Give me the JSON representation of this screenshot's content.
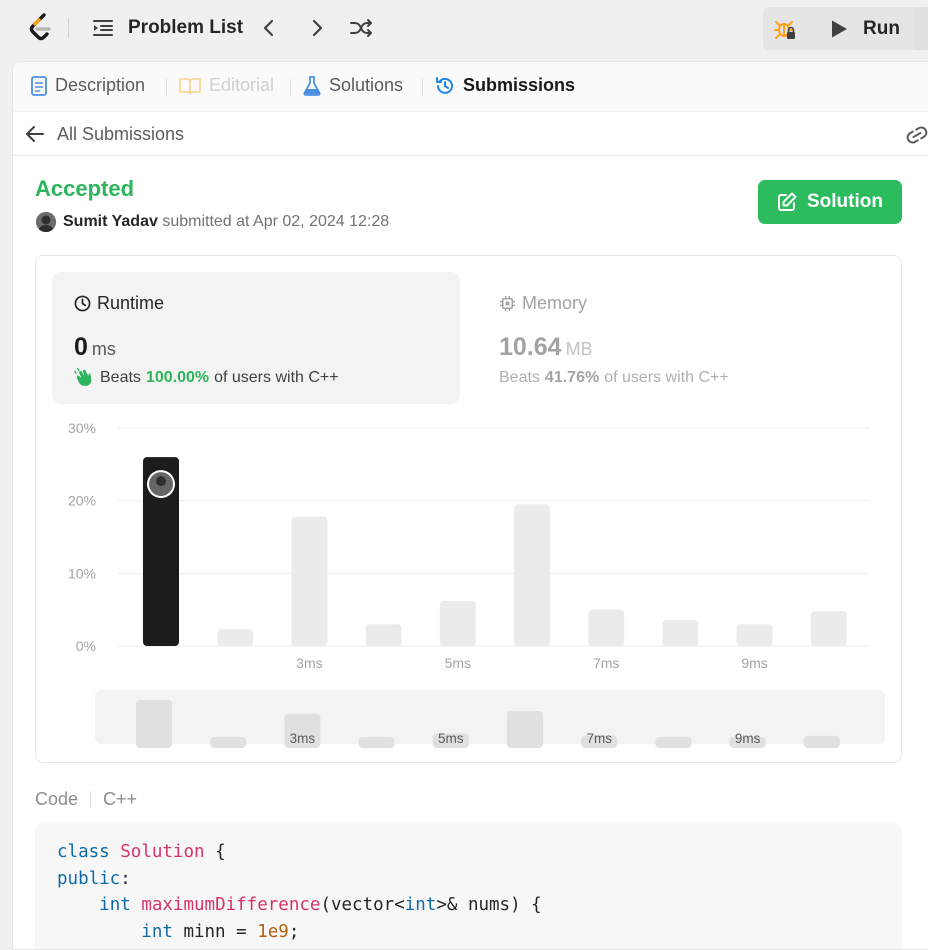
{
  "topbar": {
    "problem_list": "Problem List",
    "run": "Run"
  },
  "tabs": [
    {
      "label": "Description",
      "icon": "document-icon"
    },
    {
      "label": "Editorial",
      "icon": "book-icon"
    },
    {
      "label": "Solutions",
      "icon": "flask-icon"
    },
    {
      "label": "Submissions",
      "icon": "history-icon"
    }
  ],
  "subheader": {
    "all_submissions": "All Submissions"
  },
  "result": {
    "status": "Accepted",
    "user": "Sumit Yadav",
    "submitted_text": "submitted at Apr 02, 2024 12:28",
    "solution_button": "Solution"
  },
  "runtime": {
    "label": "Runtime",
    "value": "0",
    "unit": "ms",
    "beats_prefix": "Beats",
    "beats_pct": "100.00%",
    "beats_suffix": "of users with C++"
  },
  "memory": {
    "label": "Memory",
    "value": "10.64",
    "unit": "MB",
    "beats_prefix": "Beats",
    "beats_pct": "41.76%",
    "beats_suffix": "of users with C++"
  },
  "chart_data": {
    "type": "bar",
    "ylabel": "",
    "xlabel": "",
    "yticks": [
      "30%",
      "20%",
      "10%",
      "0%"
    ],
    "ylim": [
      0,
      30
    ],
    "xtick_labels": [
      "",
      "",
      "3ms",
      "",
      "5ms",
      "",
      "7ms",
      "",
      "9ms",
      ""
    ],
    "values": [
      26,
      2.3,
      17.8,
      3,
      6.2,
      19.5,
      5,
      3.6,
      3,
      4.8
    ],
    "highlight_index": 0,
    "colors": {
      "highlight": "#1c1c1c",
      "bar": "#ebebeb",
      "overview": "#e0e0e0"
    }
  },
  "code": {
    "label": "Code",
    "language": "C++",
    "lines": [
      [
        [
          "kw",
          "class"
        ],
        [
          "",
          " "
        ],
        [
          "cls",
          "Solution"
        ],
        [
          "",
          " {"
        ]
      ],
      [
        [
          "kw",
          "public"
        ],
        [
          "",
          ":"
        ]
      ],
      [
        [
          "",
          "    "
        ],
        [
          "kw",
          "int"
        ],
        [
          "",
          " "
        ],
        [
          "fn",
          "maximumDifference"
        ],
        [
          "",
          "(vector<"
        ],
        [
          "kw",
          "int"
        ],
        [
          "",
          ">& nums) {"
        ]
      ],
      [
        [
          "",
          "        "
        ],
        [
          "kw",
          "int"
        ],
        [
          "",
          " minn = "
        ],
        [
          "num",
          "1e9"
        ],
        [
          "",
          ";"
        ]
      ]
    ]
  }
}
